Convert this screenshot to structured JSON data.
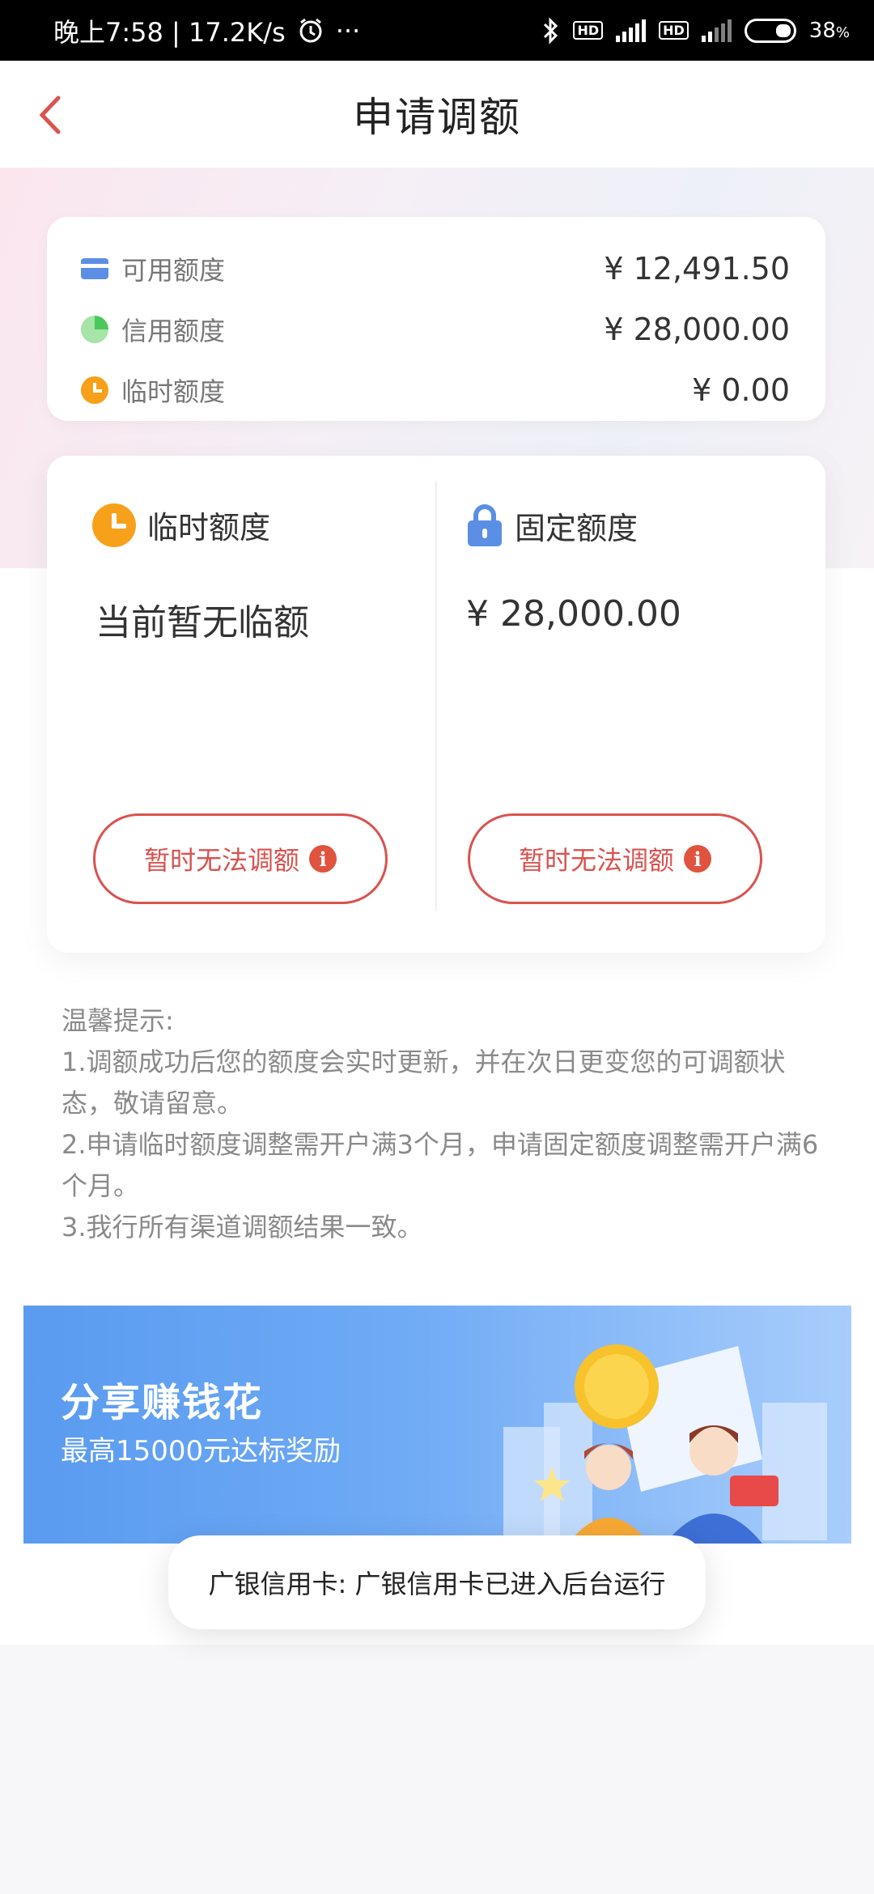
{
  "status_bar": {
    "time": "晚上7:58 | 17.2K/s",
    "more": "···",
    "battery": "38",
    "battery_unit": "%"
  },
  "header": {
    "title": "申请调额"
  },
  "summary": {
    "items": [
      {
        "label": "可用额度",
        "value": "¥ 12,491.50",
        "icon": "card-icon"
      },
      {
        "label": "信用额度",
        "value": "¥ 28,000.00",
        "icon": "pie-icon"
      },
      {
        "label": "临时额度",
        "value": "¥ 0.00",
        "icon": "clock-icon"
      }
    ]
  },
  "main": {
    "temporary": {
      "title": "临时额度",
      "value": "当前暂无临额",
      "button": "暂时无法调额"
    },
    "fixed": {
      "title": "固定额度",
      "value": "¥ 28,000.00",
      "button": "暂时无法调额"
    }
  },
  "tips": {
    "heading": "温馨提示:",
    "lines": [
      "1.调额成功后您的额度会实时更新，并在次日更变您的可调额状态，敬请留意。",
      "2.申请临时额度调整需开户满3个月，申请固定额度调整需开户满6个月。",
      "3.我行所有渠道调额结果一致。"
    ]
  },
  "banner": {
    "title": "分享赚钱花",
    "subtitle": "最高15000元达标奖励"
  },
  "toast": {
    "text": "广银信用卡: 广银信用卡已进入后台运行"
  },
  "colors": {
    "accent_red": "#d9534f",
    "blue": "#5b8fe6",
    "orange": "#f7a11a",
    "green": "#4cc75a"
  }
}
